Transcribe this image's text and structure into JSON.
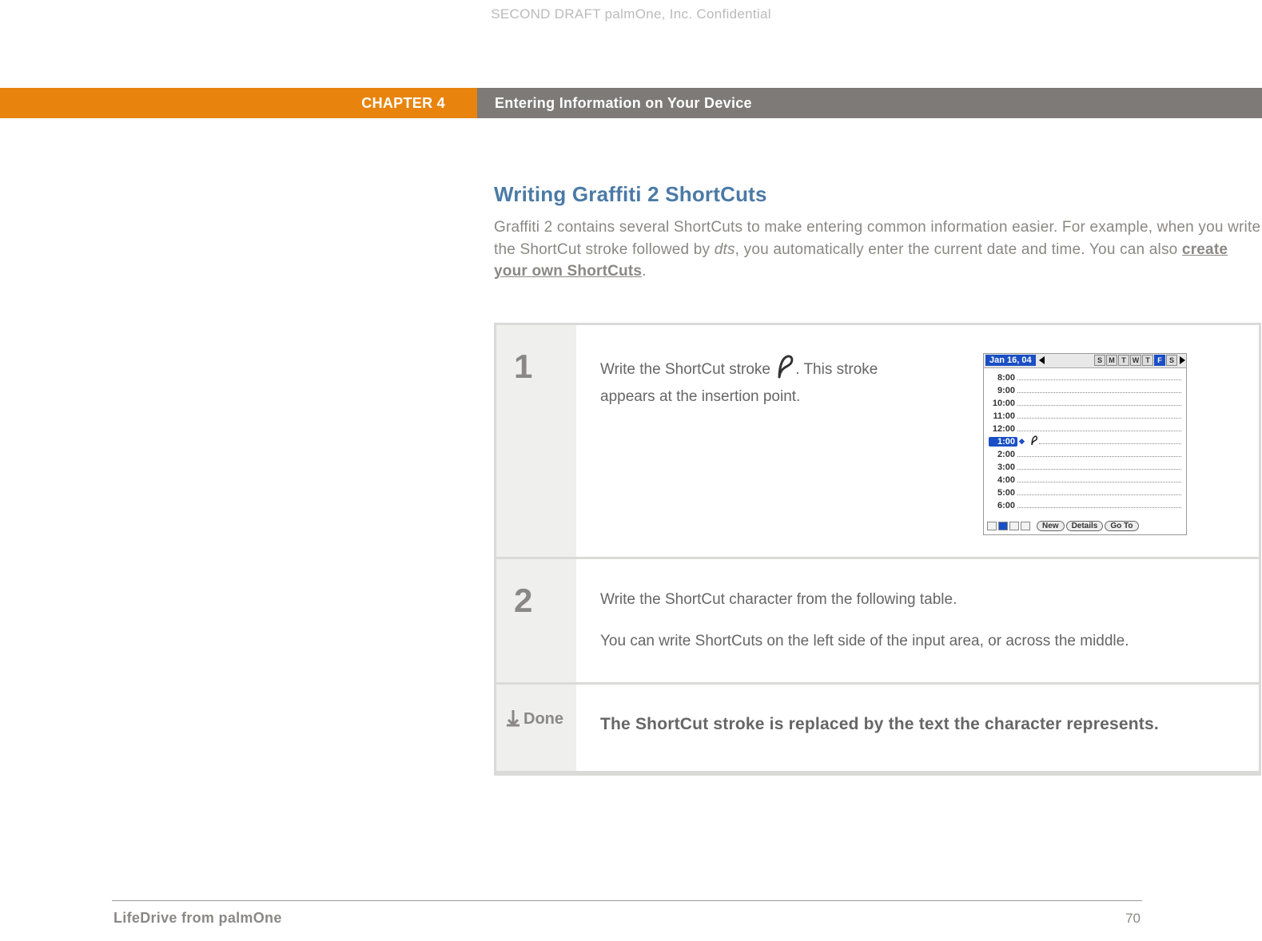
{
  "watermark": "SECOND DRAFT palmOne, Inc.  Confidential",
  "header": {
    "chapter": "CHAPTER 4",
    "title": "Entering Information on Your Device"
  },
  "section": {
    "heading": "Writing Graffiti 2 ShortCuts",
    "intro_1": "Graffiti 2 contains several ShortCuts to make entering common information easier. For example, when you write the ShortCut stroke followed by ",
    "intro_em": "dts",
    "intro_2": ", you automatically enter the current date and time. You can also ",
    "intro_link": "create your own ShortCuts",
    "intro_3": "."
  },
  "steps": {
    "s1": {
      "num": "1",
      "text_a": "Write the ShortCut stroke ",
      "text_b": ". This stroke appears at the insertion point."
    },
    "s2": {
      "num": "2",
      "line1": "Write the ShortCut character from the following table.",
      "line2": "You can write ShortCuts on the left side of the input area, or across the middle."
    },
    "done": {
      "label": "Done",
      "text": "The ShortCut stroke is replaced by the text the character represents."
    }
  },
  "screenshot": {
    "date": "Jan 16, 04",
    "days": [
      "S",
      "M",
      "T",
      "W",
      "T",
      "F",
      "S"
    ],
    "active_day_index": 5,
    "times": [
      "8:00",
      "9:00",
      "10:00",
      "11:00",
      "12:00",
      "1:00",
      "2:00",
      "3:00",
      "4:00",
      "5:00",
      "6:00"
    ],
    "selected_time_index": 5,
    "buttons": {
      "new": "New",
      "details": "Details",
      "goto": "Go To"
    }
  },
  "footer": {
    "left": "LifeDrive from palmOne",
    "right": "70"
  }
}
